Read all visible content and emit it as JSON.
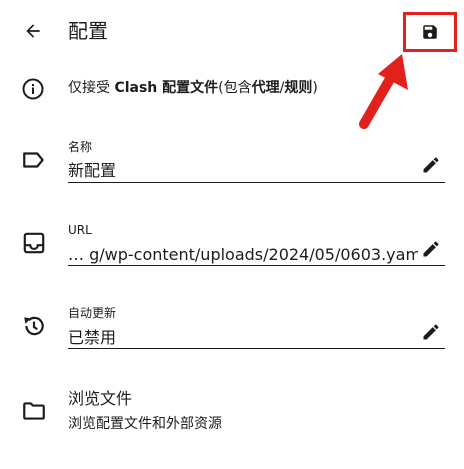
{
  "header": {
    "title": "配置",
    "back_icon": "arrow-left-icon",
    "save_icon": "save-icon"
  },
  "info": {
    "icon": "info-icon",
    "text_prefix": "仅接受 ",
    "text_bold1": "Clash 配置文件",
    "text_mid": "(包含",
    "text_bold2": "代理",
    "text_slash": "/",
    "text_bold3": "规则",
    "text_suffix": ")"
  },
  "fields": {
    "name": {
      "label": "名称",
      "value": "新配置",
      "icon": "label-tag-icon"
    },
    "url": {
      "label": "URL",
      "value": "… g/wp-content/uploads/2024/05/0603.yam",
      "icon": "inbox-icon"
    },
    "auto_update": {
      "label": "自动更新",
      "value": "已禁用",
      "icon": "history-clock-icon"
    }
  },
  "browse": {
    "title": "浏览文件",
    "subtitle": "浏览配置文件和外部资源",
    "icon": "folder-icon"
  },
  "colors": {
    "highlight": "#e3211c",
    "text": "#1c1b1f",
    "background": "#ffffff"
  }
}
